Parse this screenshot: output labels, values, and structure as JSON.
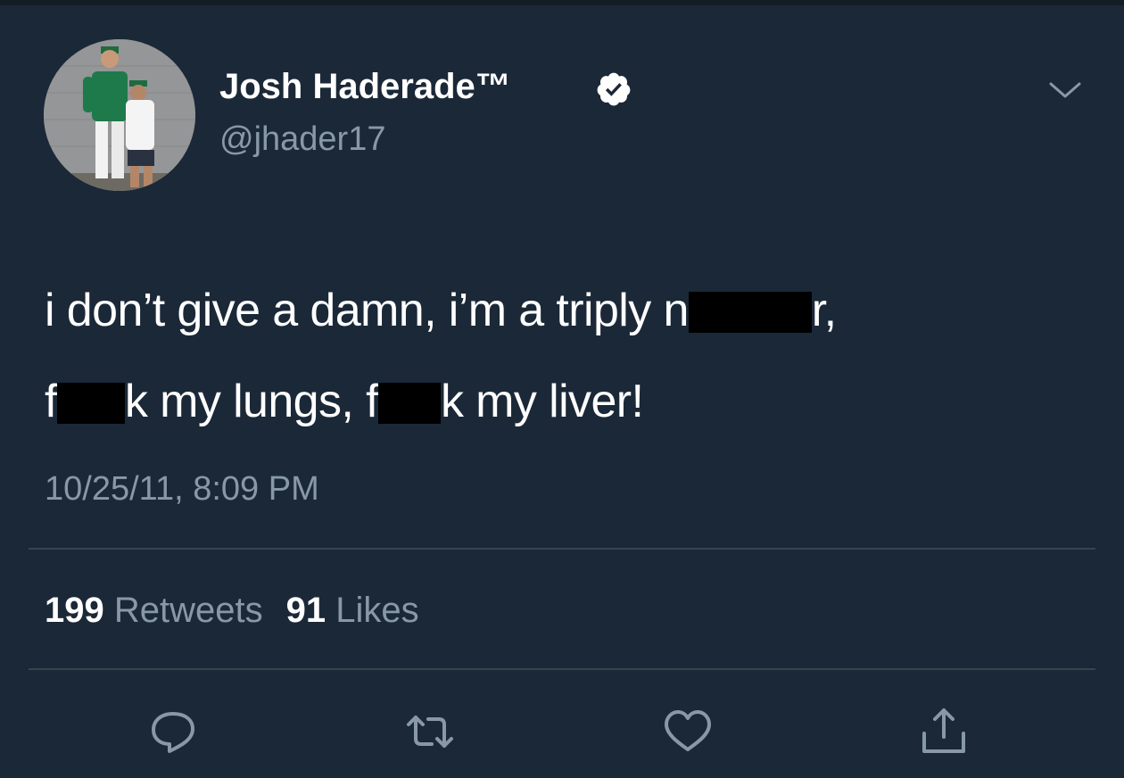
{
  "tweet": {
    "author": {
      "display_name": "Josh Haderade™",
      "handle": "@jhader17",
      "verified": true,
      "verified_icon": "verified-badge-icon",
      "avatar": "avatar-photo"
    },
    "text": {
      "line1": {
        "before": "i don’t give a damn, i’m a triply n",
        "after": "r,"
      },
      "line2": {
        "part1": "f",
        "part2": "k my lungs, f",
        "part3": "k my liver!"
      }
    },
    "timestamp": "10/25/11, 8:09 PM",
    "stats": {
      "retweets_count": "199",
      "retweets_label": "Retweets",
      "likes_count": "91",
      "likes_label": "Likes"
    },
    "actions": [
      {
        "icon": "reply-icon"
      },
      {
        "icon": "retweet-icon"
      },
      {
        "icon": "like-icon"
      },
      {
        "icon": "share-icon"
      }
    ],
    "menu_icon": "chevron-down-icon"
  },
  "colors": {
    "background": "#1b2837",
    "text_primary": "#ffffff",
    "text_secondary": "#8899a6",
    "divider": "#38444d",
    "redaction": "#000000"
  }
}
